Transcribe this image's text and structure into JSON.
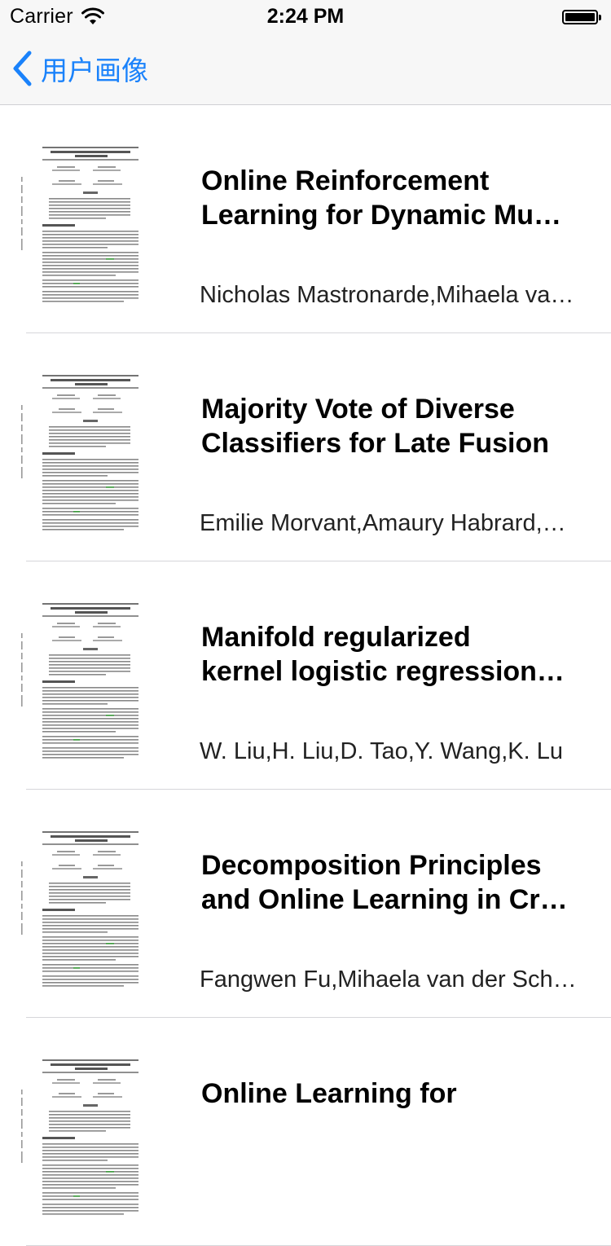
{
  "status_bar": {
    "carrier": "Carrier",
    "time": "2:24 PM"
  },
  "nav": {
    "back_label": "用户画像"
  },
  "papers": [
    {
      "title_line1": "Online Reinforcement",
      "title_line2": "Learning for Dynamic Mu…",
      "authors": "Nicholas Mastronarde,Mihaela va…"
    },
    {
      "title_line1": "Majority Vote of Diverse",
      "title_line2": "Classifiers for Late Fusion",
      "authors": "Emilie Morvant,Amaury Habrard,…"
    },
    {
      "title_line1": "Manifold regularized",
      "title_line2": "kernel logistic regression…",
      "authors": "W. Liu,H. Liu,D. Tao,Y. Wang,K. Lu"
    },
    {
      "title_line1": "Decomposition Principles",
      "title_line2": "and Online Learning in Cr…",
      "authors": "Fangwen Fu,Mihaela van der Sch…"
    },
    {
      "title_line1": "Online Learning for",
      "title_line2": "",
      "authors": ""
    }
  ]
}
